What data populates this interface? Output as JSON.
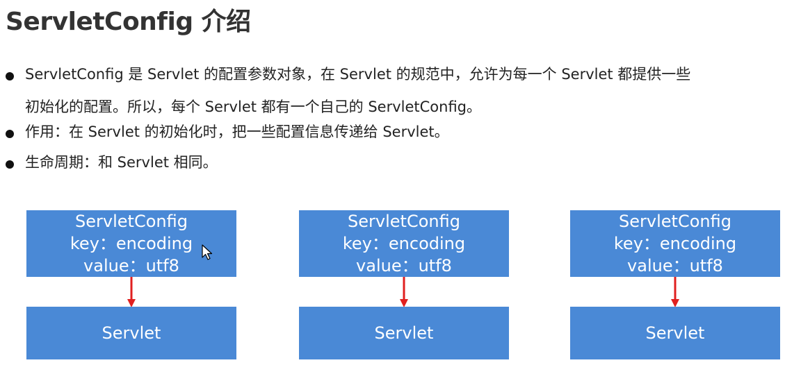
{
  "slide": {
    "title": "ServletConfig 介绍",
    "bullets": [
      {
        "lines": [
          "ServletConfig 是 Servlet 的配置参数对象，在 Servlet 的规范中，允许为每一个 Servlet 都提供一些",
          "初始化的配置。所以，每个 Servlet 都有一个自己的 ServletConfig。"
        ]
      },
      {
        "lines": [
          "作用：在 Servlet 的初始化时，把一些配置信息传递给 Servlet。"
        ]
      },
      {
        "lines": [
          "生命周期：和 Servlet 相同。"
        ]
      }
    ]
  },
  "diagram": {
    "box_color": "#4a89d6",
    "arrow_color": "#e02020",
    "columns": [
      {
        "config": {
          "title": "ServletConfig",
          "key_line": "key：encoding",
          "value_line": "value：utf8"
        },
        "servlet": "Servlet"
      },
      {
        "config": {
          "title": "ServletConfig",
          "key_line": "key：encoding",
          "value_line": "value：utf8"
        },
        "servlet": "Servlet"
      },
      {
        "config": {
          "title": "ServletConfig",
          "key_line": "key：encoding",
          "value_line": "value：utf8"
        },
        "servlet": "Servlet"
      }
    ]
  }
}
